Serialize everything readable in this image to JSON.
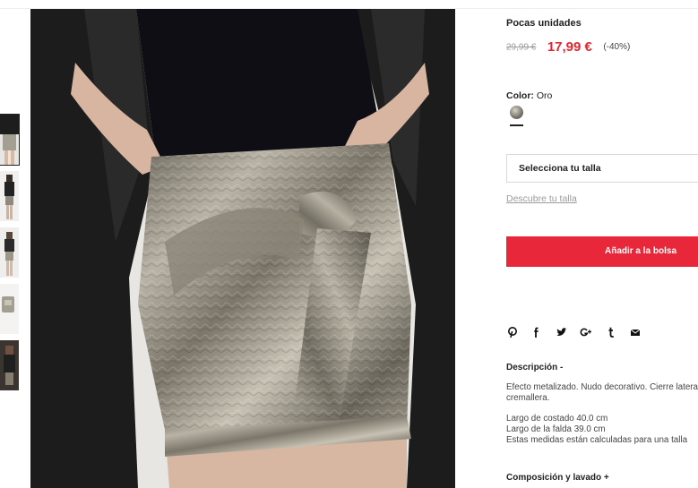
{
  "product": {
    "stock_status": "Pocas unidades",
    "old_price": "29,99 €",
    "new_price": "17,99 €",
    "discount": "(-40%)",
    "color_label": "Color:",
    "color_value": "Oro",
    "size_select_label": "Selecciona tu talla",
    "size_guide_link": "Descubre tu talla",
    "add_to_bag_label": "Añadir a la bolsa"
  },
  "share": [
    "pinterest-icon",
    "facebook-icon",
    "twitter-icon",
    "google-plus-icon",
    "tumblr-icon",
    "email-icon"
  ],
  "description": {
    "title": "Descripción -",
    "paragraph": "Efecto metalizado. Nudo decorativo. Cierre lateral con cremallera.",
    "line_1": "Largo de costado 40.0 cm",
    "line_2": "Largo de la falda 39.0 cm",
    "line_3": "Estas medidas están calculadas para una talla"
  },
  "composition": {
    "title": "Composición y lavado +"
  },
  "colors": {
    "price_red": "#e1252f",
    "button_red": "#e8283a",
    "muted_gray": "#9a9a9a"
  }
}
